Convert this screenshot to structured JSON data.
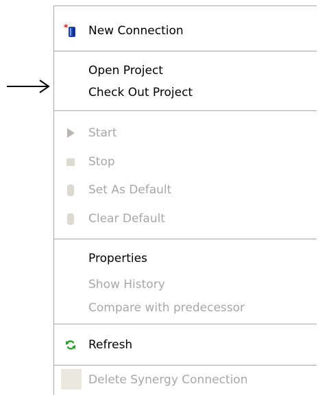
{
  "colors": {
    "enabled_text": "#000000",
    "disabled_text": "#a7a6aa",
    "separator": "#a7a6aa",
    "refresh_icon": "#2e9e2e",
    "disabled_icon": "#cfccc3",
    "connection_icon": "#1c3fa8",
    "new_star": "#e01010"
  },
  "menu": {
    "new_connection": {
      "label": "New Connection",
      "icon": "new-connection-icon"
    },
    "open_project": {
      "label": "Open Project"
    },
    "check_out_project": {
      "label": "Check Out Project"
    },
    "start": {
      "label": "Start",
      "icon": "play-icon"
    },
    "stop": {
      "label": "Stop",
      "icon": "stop-icon"
    },
    "set_as_default": {
      "label": "Set As Default",
      "icon": "database-icon"
    },
    "clear_default": {
      "label": "Clear Default",
      "icon": "database-icon"
    },
    "properties": {
      "label": "Properties"
    },
    "show_history": {
      "label": "Show History"
    },
    "compare_with_predecessor": {
      "label": "Compare with predecessor"
    },
    "refresh": {
      "label": "Refresh",
      "icon": "refresh-icon"
    },
    "delete_synergy_connection": {
      "label": "Delete Synergy Connection",
      "icon": "delete-icon"
    }
  },
  "annotation": {
    "icon": "right-arrow-icon"
  }
}
